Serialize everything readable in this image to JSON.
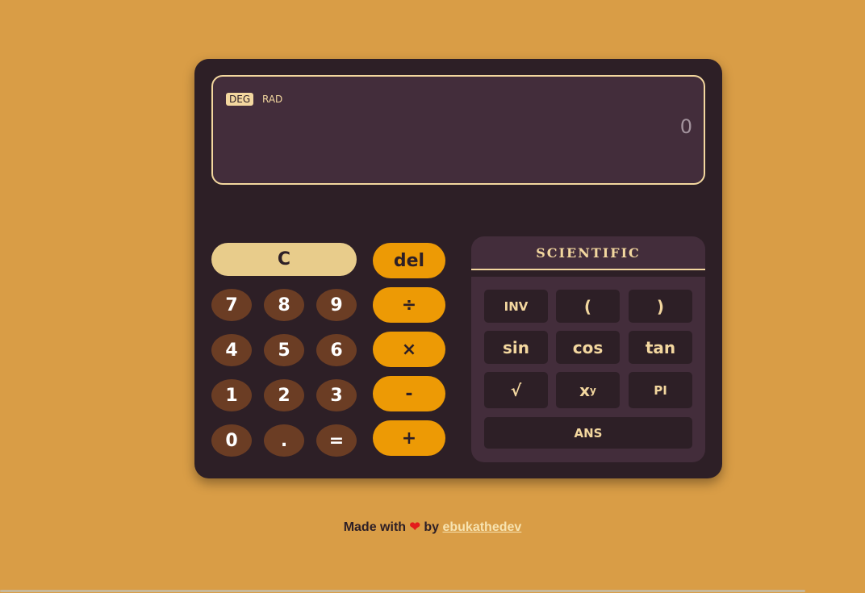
{
  "display": {
    "mode_deg": "DEG",
    "mode_rad": "RAD",
    "value": "0"
  },
  "keypad": {
    "clear": "C",
    "del": "del",
    "digits": {
      "seven": "7",
      "eight": "8",
      "nine": "9",
      "four": "4",
      "five": "5",
      "six": "6",
      "one": "1",
      "two": "2",
      "three": "3",
      "zero": "0",
      "decimal": ".",
      "equals": "="
    },
    "ops": {
      "divide": "÷",
      "multiply": "×",
      "subtract": "-",
      "add": "+"
    }
  },
  "scientific": {
    "title": "SCIENTIFIC",
    "inv": "INV",
    "open_paren": "(",
    "close_paren": ")",
    "sin": "sin",
    "cos": "cos",
    "tan": "tan",
    "sqrt": "√",
    "power_base": "x",
    "power_exp": "y",
    "pi": "PI",
    "ans": "ANS"
  },
  "footer": {
    "made_with": "Made with",
    "heart": "❤",
    "by": "by",
    "author": "ebukathedev"
  },
  "colors": {
    "page_bg": "#d99d46",
    "calc_bg": "#2d1f26",
    "display_bg": "#432d3b",
    "accent": "#f3d79f",
    "number_key": "#6b3d24",
    "operator_key": "#ed9a05",
    "clear_key": "#e8cc8b"
  }
}
